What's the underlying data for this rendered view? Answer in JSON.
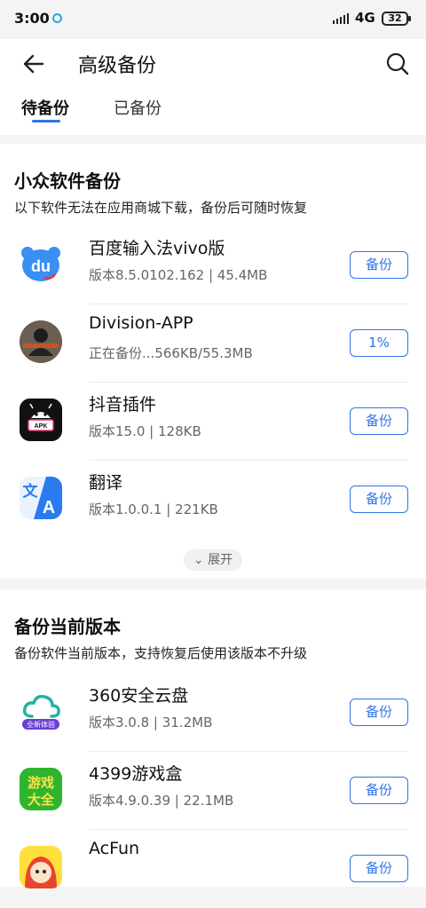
{
  "status_bar": {
    "time": "3:00",
    "network": "4G",
    "battery": "32"
  },
  "header": {
    "title": "高级备份",
    "tabs": [
      {
        "label": "待备份"
      },
      {
        "label": "已备份"
      }
    ]
  },
  "section1": {
    "title": "小众软件备份",
    "subtitle": "以下软件无法在应用商城下载，备份后可随时恢复",
    "expand_label": "展开",
    "items": [
      {
        "name": "百度输入法vivo版",
        "meta": "版本8.5.0102.162  |  45.4MB",
        "action": "备份",
        "icon": "baidu-input-icon"
      },
      {
        "name": "Division-APP",
        "meta": "正在备份...566KB/55.3MB",
        "action": "1%",
        "progress": 0.01,
        "icon": "division-app-icon"
      },
      {
        "name": "抖音插件",
        "meta": "版本15.0  |  128KB",
        "action": "备份",
        "icon": "apk-plugin-icon"
      },
      {
        "name": "翻译",
        "meta": "版本1.0.0.1  |  221KB",
        "action": "备份",
        "icon": "translate-icon"
      }
    ]
  },
  "section2": {
    "title": "备份当前版本",
    "subtitle": "备份软件当前版本，支持恢复后使用该版本不升级",
    "items": [
      {
        "name": "360安全云盘",
        "meta": "版本3.0.8  |  31.2MB",
        "action": "备份",
        "icon": "cloud-disk-icon",
        "badge": "全新体验"
      },
      {
        "name": "4399游戏盒",
        "meta": "版本4.9.0.39  |  22.1MB",
        "action": "备份",
        "icon": "game-box-icon",
        "icon_text": "游戏大全"
      },
      {
        "name": "AcFun",
        "meta": "",
        "action": "备份",
        "icon": "acfun-icon"
      }
    ]
  },
  "colors": {
    "accent": "#2f74e6",
    "background": "#f4f4f4"
  }
}
